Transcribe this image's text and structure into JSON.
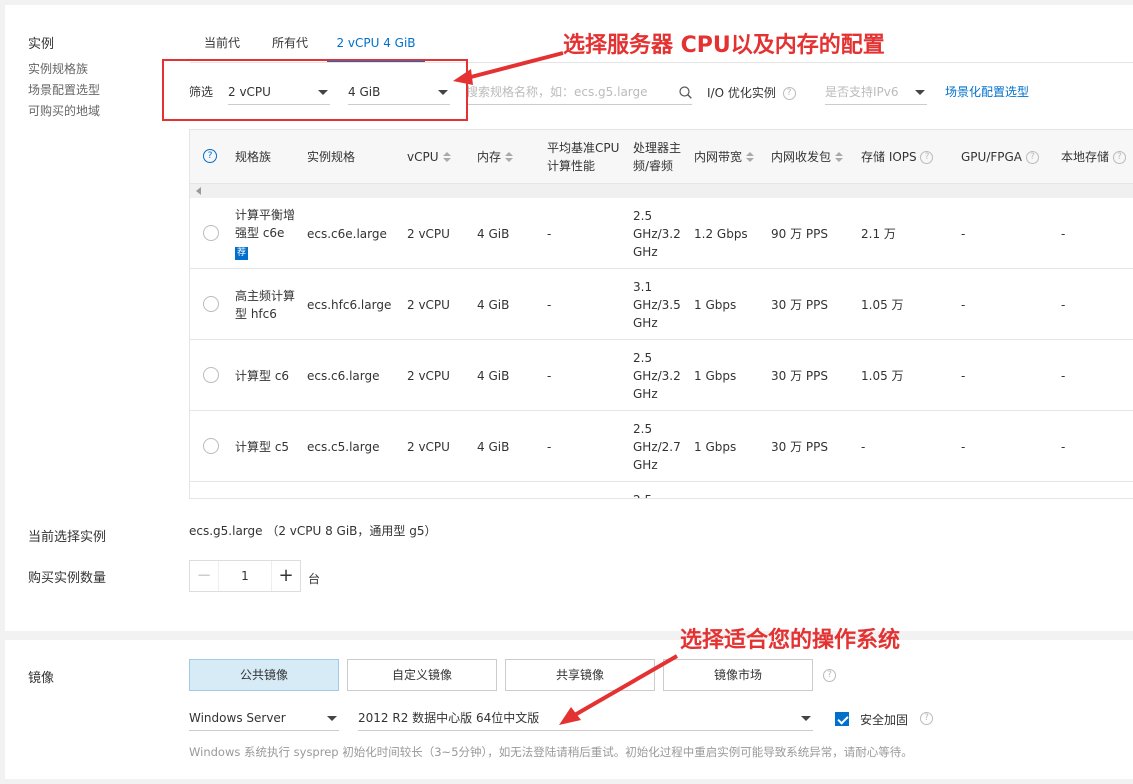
{
  "instance": {
    "section_title": "实例",
    "side_links": [
      "实例规格族",
      "场景配置选型",
      "可购买的地域"
    ],
    "tabs": [
      "当前代",
      "所有代",
      "2 vCPU 4 GiB"
    ],
    "filter": {
      "label": "筛选",
      "cpu": "2 vCPU",
      "memory": "4 GiB",
      "search_placeholder": "搜索规格名称，如：ecs.g5.large",
      "io_label": "I/O 优化实例",
      "ipv6": "是否支持IPv6",
      "scene_link": "场景化配置选型"
    },
    "table": {
      "headers": {
        "family": "规格族",
        "spec": "实例规格",
        "vcpu": "vCPU",
        "memory": "内存",
        "baseline_1": "平均基准CPU",
        "baseline_2": "计算性能",
        "freq_1": "处理器主",
        "freq_2": "频/睿频",
        "bandwidth": "内网带宽",
        "pps": "内网收发包",
        "iops": "存储 IOPS",
        "gpu": "GPU/FPGA",
        "local": "本地存储"
      },
      "rows": [
        {
          "family": [
            "计算平衡增",
            "强型 c6e"
          ],
          "badge": "荐",
          "spec": "ecs.c6e.large",
          "vcpu": "2 vCPU",
          "memory": "4 GiB",
          "baseline": "-",
          "freq": [
            "2.5",
            "GHz/3.2",
            "GHz"
          ],
          "bandwidth": "1.2 Gbps",
          "pps": "90 万 PPS",
          "iops": "2.1 万",
          "gpu": "-",
          "local": "-"
        },
        {
          "family": [
            "高主频计算",
            "型 hfc6"
          ],
          "badge": "",
          "spec": "ecs.hfc6.large",
          "vcpu": "2 vCPU",
          "memory": "4 GiB",
          "baseline": "-",
          "freq": [
            "3.1",
            "GHz/3.5",
            "GHz"
          ],
          "bandwidth": "1 Gbps",
          "pps": "30 万 PPS",
          "iops": "1.05 万",
          "gpu": "-",
          "local": "-"
        },
        {
          "family": [
            "计算型 c6"
          ],
          "badge": "",
          "spec": "ecs.c6.large",
          "vcpu": "2 vCPU",
          "memory": "4 GiB",
          "baseline": "-",
          "freq": [
            "2.5",
            "GHz/3.2",
            "GHz"
          ],
          "bandwidth": "1 Gbps",
          "pps": "30 万 PPS",
          "iops": "1.05 万",
          "gpu": "-",
          "local": "-"
        },
        {
          "family": [
            "计算型 c5"
          ],
          "badge": "",
          "spec": "ecs.c5.large",
          "vcpu": "2 vCPU",
          "memory": "4 GiB",
          "baseline": "-",
          "freq": [
            "2.5",
            "GHz/2.7",
            "GHz"
          ],
          "bandwidth": "1 Gbps",
          "pps": "30 万 PPS",
          "iops": "-",
          "gpu": "-",
          "local": "-"
        }
      ],
      "partial_next": "2.5"
    },
    "current_label": "当前选择实例",
    "current_value": "ecs.g5.large （2 vCPU 8 GiB，通用型 g5）",
    "qty_label": "购买实例数量",
    "qty_value": "1",
    "qty_unit": "台"
  },
  "annotations": {
    "top": "选择服务器 CPU以及内存的配置",
    "bottom": "选择适合您的操作系统",
    "color": "#e43232"
  },
  "image": {
    "section_title": "镜像",
    "tabs": [
      "公共镜像",
      "自定义镜像",
      "共享镜像",
      "镜像市场"
    ],
    "os": "Windows Server",
    "version": "2012 R2 数据中心版 64位中文版",
    "security_label": "安全加固",
    "note": "Windows 系统执行 sysprep 初始化时间较长（3~5分钟），如无法登陆请稍后重试。初始化过程中重启实例可能导致系统异常，请耐心等待。"
  },
  "colors": {
    "accent": "#0070cc",
    "active_tab_bg": "#d7ebf7"
  }
}
